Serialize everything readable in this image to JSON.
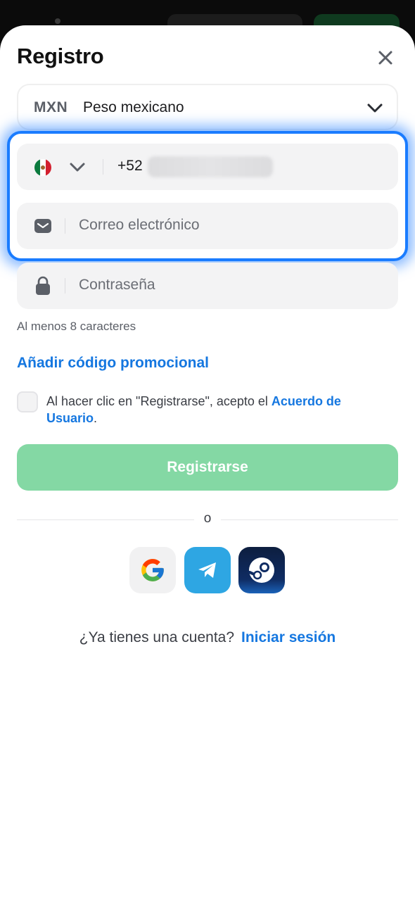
{
  "dialog": {
    "title": "Registro"
  },
  "currency": {
    "code": "MXN",
    "name": "Peso mexicano"
  },
  "phone": {
    "country_code": "+52",
    "flag": "mexico-flag-icon"
  },
  "email": {
    "placeholder": "Correo electrónico"
  },
  "password": {
    "placeholder": "Contraseña",
    "hint": "Al menos 8 caracteres"
  },
  "promo": {
    "label": "Añadir código promocional"
  },
  "terms": {
    "text": "Al hacer clic en \"Registrarse\", acepto el ",
    "link": "Acuerdo de Usuario",
    "end": "."
  },
  "actions": {
    "register_label": "Registrarse"
  },
  "divider": {
    "label": "o"
  },
  "social": [
    "google-icon",
    "telegram-icon",
    "steam-icon"
  ],
  "footer": {
    "question": "¿Ya tienes una cuenta?",
    "login_link": "Iniciar sesión"
  },
  "colors": {
    "accent": "#1577e0",
    "register_disabled": "#84d8a4",
    "highlight": "#1a7cff"
  }
}
